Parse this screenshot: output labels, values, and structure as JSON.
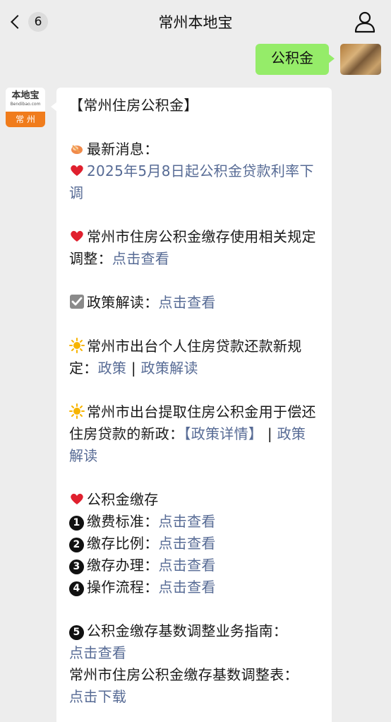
{
  "nav": {
    "title": "常州本地宝",
    "unread_count": "6",
    "back_icon": "chevron-left-icon",
    "profile_icon": "person-icon"
  },
  "sent": {
    "text": "公积金"
  },
  "bot": {
    "avatar_name": "本地宝",
    "avatar_domain": "Bendibao.com",
    "avatar_city": "常  州"
  },
  "reply": {
    "header": "【常州住房公积金】",
    "latest_label": "最新消息：",
    "news_link": "2025年5月8日起公积金贷款利率下调",
    "item1_text": "常州市住房公积金缴存使用相关规定调整：",
    "item1_link": "点击查看",
    "item2_text": "政策解读：",
    "item2_link": "点击查看",
    "item3_text": "常州市出台个人住房贷款还款新规定：",
    "item3_link_a": "政策",
    "item3_sep": " | ",
    "item3_link_b": "政策解读",
    "item4_text": "常州市出台提取住房公积金用于偿还住房贷款的新政：",
    "item4_link_a": "【政策详情】",
    "item4_sep": " | ",
    "item4_link_b": "政策解读",
    "section_title": "公积金缴存",
    "list": [
      {
        "num": "1",
        "label": "缴费标准：",
        "link": "点击查看"
      },
      {
        "num": "2",
        "label": "缴存比例：",
        "link": "点击查看"
      },
      {
        "num": "3",
        "label": "缴存办理：",
        "link": "点击查看"
      },
      {
        "num": "4",
        "label": "操作流程：",
        "link": "点击查看"
      }
    ],
    "item5_num": "5",
    "item5_text": "公积金缴存基数调整业务指南：",
    "item5_link": "点击查看",
    "item6_text": "常州市住房公积金缴存基数调整表：",
    "item6_link": "点击下载"
  },
  "colors": {
    "link": "#576b95",
    "sent_bubble": "#95ec69",
    "background": "#ededed",
    "avatar_orange": "#f07c1c"
  }
}
